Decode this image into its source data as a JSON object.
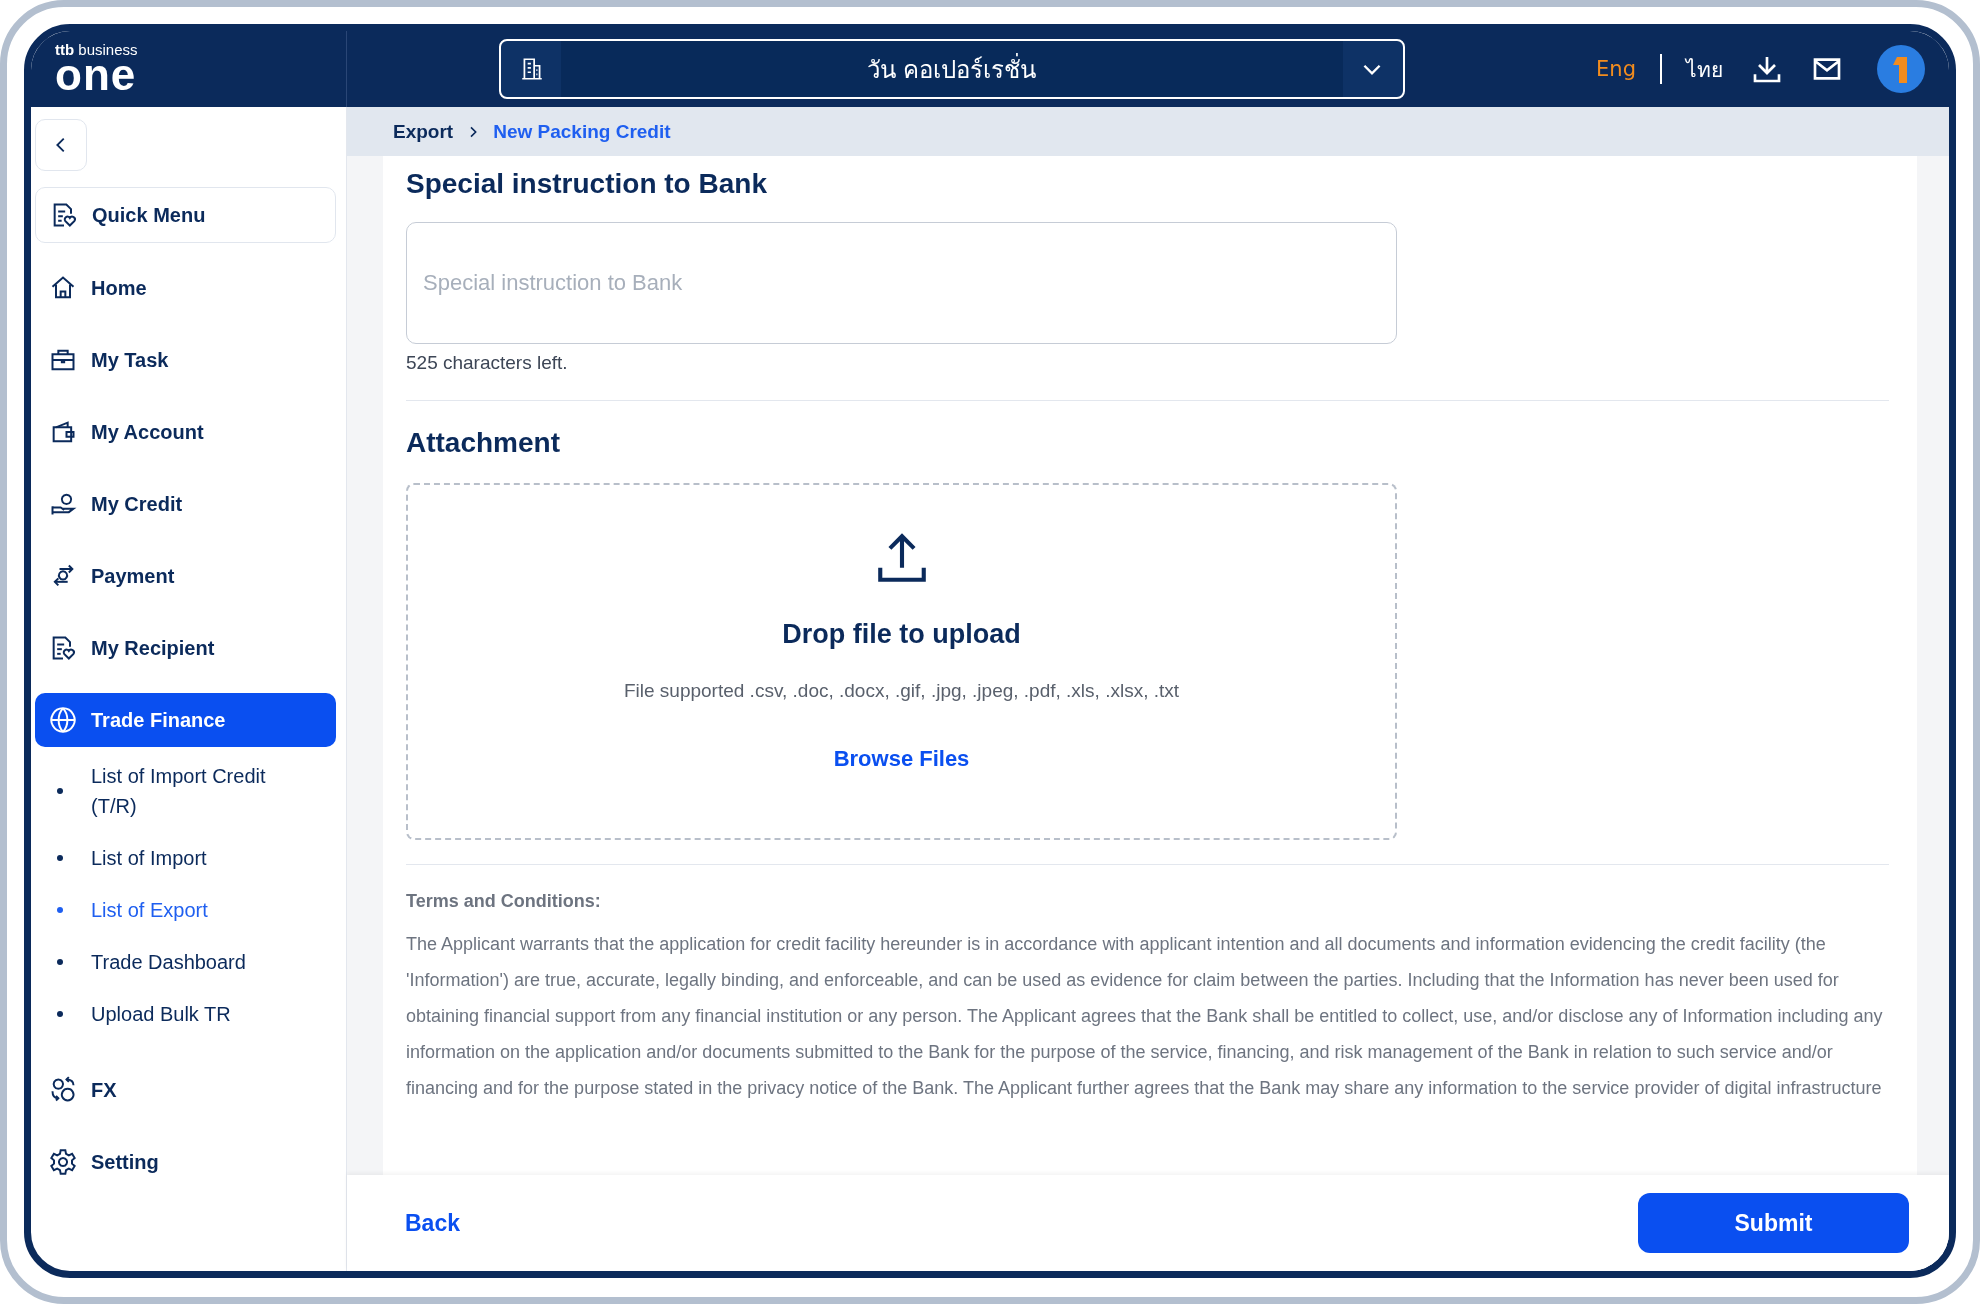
{
  "logo": {
    "brand": "ttb",
    "tagline": "business",
    "name": "one"
  },
  "company_selector": {
    "value": "วัน คอเปอร์เรชั่น"
  },
  "languages": [
    {
      "label": "Eng",
      "selected": true
    },
    {
      "label": "ไทย",
      "selected": false
    }
  ],
  "sidebar": {
    "quick_menu": {
      "label": "Quick Menu"
    },
    "items": [
      {
        "label": "Home",
        "selected": false
      },
      {
        "label": "My Task",
        "selected": false
      },
      {
        "label": "My Account",
        "selected": false
      },
      {
        "label": "My Credit",
        "selected": false
      },
      {
        "label": "Payment",
        "selected": false
      },
      {
        "label": "My Recipient",
        "selected": false
      },
      {
        "label": "Trade Finance",
        "selected": true,
        "expanded": true,
        "children": [
          {
            "label": "List of Import Credit (T/R)",
            "selected": false
          },
          {
            "label": "List of Import",
            "selected": false
          },
          {
            "label": "List of Export",
            "selected": true
          },
          {
            "label": "Trade Dashboard",
            "selected": false
          },
          {
            "label": "Upload Bulk TR",
            "selected": false
          }
        ]
      },
      {
        "label": "FX",
        "selected": false
      },
      {
        "label": "Setting",
        "selected": false
      }
    ]
  },
  "breadcrumb": [
    {
      "label": "Export",
      "selected": false
    },
    {
      "label": "New Packing Credit",
      "selected": true
    }
  ],
  "special_instruction": {
    "heading": "Special instruction to Bank",
    "placeholder": "Special instruction to Bank",
    "counter": "525 characters left."
  },
  "attachment": {
    "heading": "Attachment",
    "title": "Drop file to upload",
    "supported": "File supported .csv, .doc, .docx, .gif, .jpg, .jpeg, .pdf, .xls, .xlsx, .txt",
    "browse": "Browse Files"
  },
  "terms": {
    "heading": "Terms and Conditions:",
    "text": "The Applicant warrants that the application for credit facility hereunder is in accordance with applicant intention and all documents and information evidencing the credit facility (the 'Information') are true, accurate, legally binding, and enforceable, and can be used as evidence for claim between the parties. Including that the Information has never been used for obtaining financial support from any financial institution or any person. The Applicant agrees that the Bank shall be entitled to collect, use, and/or disclose any of Information including any information on the application and/or documents submitted to the Bank for the purpose of the service, financing, and risk management of the Bank in relation to such service and/or financing and for the purpose stated in the privacy notice of the Bank. The Applicant further agrees that the Bank may share any information to the service provider of digital infrastructure"
  },
  "footer": {
    "back": "Back",
    "submit": "Submit"
  }
}
